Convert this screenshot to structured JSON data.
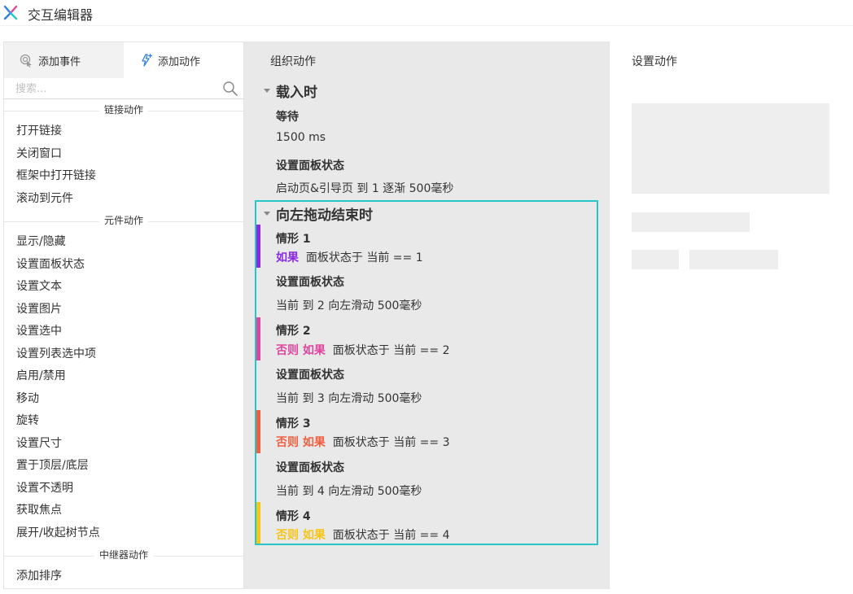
{
  "window": {
    "title": "交互编辑器"
  },
  "tabs": {
    "add_event": "添加事件",
    "add_action": "添加动作"
  },
  "search": {
    "placeholder": "搜索..."
  },
  "library": {
    "link_group": "链接动作",
    "link_items": [
      "打开链接",
      "关闭窗口",
      "框架中打开链接",
      "滚动到元件"
    ],
    "widget_group": "元件动作",
    "widget_items": [
      "显示/隐藏",
      "设置面板状态",
      "设置文本",
      "设置图片",
      "设置选中",
      "设置列表选中项",
      "启用/禁用",
      "移动",
      "旋转",
      "设置尺寸",
      "置于顶层/底层",
      "设置不透明",
      "获取焦点",
      "展开/收起树节点"
    ],
    "repeater_group": "中继器动作",
    "repeater_items": [
      "添加排序"
    ]
  },
  "organize": {
    "title": "组织动作",
    "events": [
      {
        "name": "载入时",
        "actions": [
          {
            "title": "等待",
            "detail": "1500 ms"
          },
          {
            "title": "设置面板状态",
            "detail": "启动页&引导页 到 1 逐渐 500毫秒"
          }
        ]
      },
      {
        "name": "向左拖动结束时",
        "cases": [
          {
            "name": "情形 1",
            "keyword": "如果",
            "condition": "面板状态于 当前 == 1",
            "color": "#8a2be2",
            "action_title": "设置面板状态",
            "action_detail": "当前 到 2 向左滑动 500毫秒"
          },
          {
            "name": "情形 2",
            "keyword": "否则 如果",
            "condition": "面板状态于 当前 == 2",
            "color": "#e0459e",
            "action_title": "设置面板状态",
            "action_detail": "当前 到 3 向左滑动 500毫秒"
          },
          {
            "name": "情形 3",
            "keyword": "否则 如果",
            "condition": "面板状态于 当前 == 3",
            "color": "#f06040",
            "action_title": "设置面板状态",
            "action_detail": "当前 到 4 向左滑动 500毫秒"
          },
          {
            "name": "情形 4",
            "keyword": "否则 如果",
            "condition": "面板状态于 当前 == 4",
            "color": "#f5c518"
          }
        ]
      }
    ]
  },
  "configure": {
    "title": "设置动作"
  },
  "colors": {
    "selection": "#27c5c9",
    "panel_gray": "#e9e9e9"
  }
}
